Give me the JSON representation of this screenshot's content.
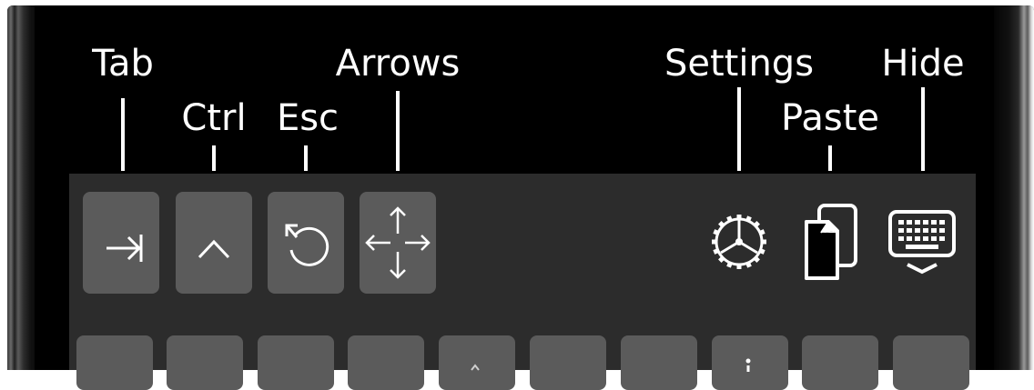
{
  "callouts": {
    "tab": "Tab",
    "ctrl": "Ctrl",
    "esc": "Esc",
    "arrows": "Arrows",
    "settings": "Settings",
    "paste": "Paste",
    "hide": "Hide"
  },
  "toolbar": {
    "keys": [
      {
        "name": "tab-key",
        "icon": "tab-arrow-icon"
      },
      {
        "name": "ctrl-key",
        "icon": "caret-up-icon"
      },
      {
        "name": "esc-key",
        "icon": "rotate-ccw-icon"
      },
      {
        "name": "arrows-key",
        "icon": "move-arrows-icon"
      }
    ],
    "actions": [
      {
        "name": "settings-button",
        "icon": "gear-icon"
      },
      {
        "name": "paste-button",
        "icon": "paste-icon"
      },
      {
        "name": "hide-keyboard-button",
        "icon": "keyboard-hide-icon"
      }
    ]
  },
  "colors": {
    "background": "#000000",
    "toolbar": "#2c2c2c",
    "key": "#5b5b5b",
    "foreground": "#ffffff"
  }
}
